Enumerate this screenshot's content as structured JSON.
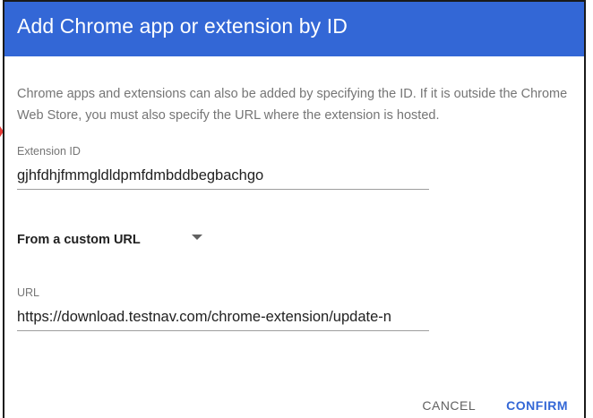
{
  "dialog": {
    "title": "Add Chrome app or extension by ID",
    "description": "Chrome apps and extensions can also be added by specifying the ID. If it is outside the Chrome Web Store, you must also specify the URL where the extension is hosted.",
    "extension_id": {
      "label": "Extension ID",
      "value": "gjhfdhjfmmgldldpmfdmbddbegbachgo"
    },
    "source_select": {
      "selected": "From a custom URL",
      "icon": "dropdown-arrow-icon"
    },
    "url": {
      "label": "URL",
      "value": "https://download.testnav.com/chrome-extension/update-n"
    },
    "actions": {
      "cancel_label": "CANCEL",
      "confirm_label": "CONFIRM"
    }
  },
  "colors": {
    "header": "#3367d6",
    "accent": "#3367d6",
    "label": "#757575",
    "text": "#212121"
  }
}
